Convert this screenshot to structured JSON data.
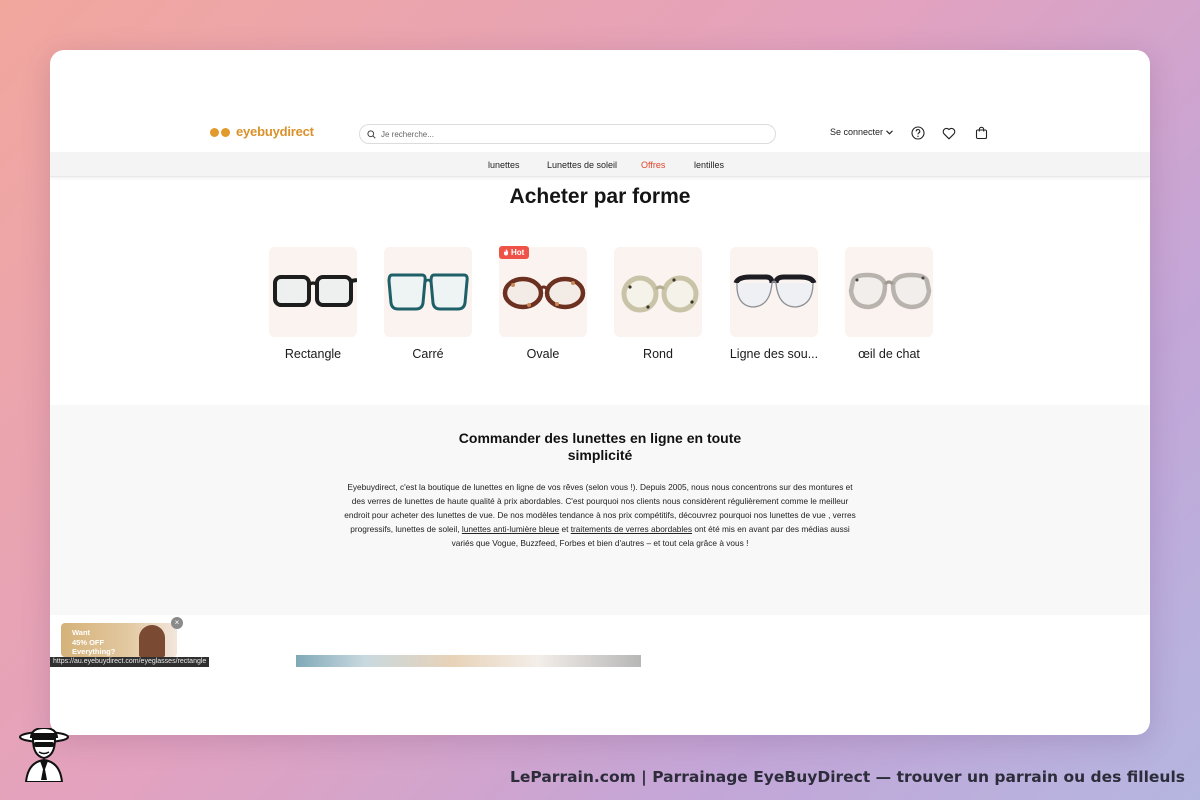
{
  "header": {
    "logo_text": "eyebuydirect",
    "search_placeholder": "Je recherche...",
    "login_label": "Se connecter",
    "icons": [
      "help-icon",
      "heart-icon",
      "cart-icon"
    ]
  },
  "nav": {
    "items": [
      {
        "label": "lunettes"
      },
      {
        "label": "Lunettes de soleil"
      },
      {
        "label": "Offres",
        "color": "#e0452b"
      },
      {
        "label": "lentilles"
      }
    ]
  },
  "shapes": {
    "title": "Acheter par forme",
    "badge": "Hot",
    "items": [
      {
        "label": "Rectangle",
        "frame_color": "#1d1d1d"
      },
      {
        "label": "Carré",
        "frame_color": "#1f6068"
      },
      {
        "label": "Ovale",
        "frame_color": "#6b3020",
        "hot": true
      },
      {
        "label": "Rond",
        "frame_color": "#c9c3a8"
      },
      {
        "label": "Ligne des sou...",
        "frame_color": "#1c1c22"
      },
      {
        "label": "œil de chat",
        "frame_color": "#b9b3ad"
      }
    ]
  },
  "info": {
    "title": "Commander des lunettes en ligne en toute simplicité",
    "p1": "Eyebuydirect, c'est la boutique de lunettes en ligne de vos rêves (selon vous !). Depuis 2005, nous nous concentrons sur des montures et des verres de lunettes de haute qualité à prix abordables. C'est pourquoi nos clients nous considèrent régulièrement comme le meilleur endroit pour acheter des lunettes de vue. De nos modèles tendance à nos prix compétitifs, découvrez pourquoi nos lunettes de vue , verres progressifs, lunettes de soleil,",
    "link1": "lunettes anti-lumière bleue",
    "and": "et",
    "link2": "traitements de verres abordables",
    "p2": "ont été mis en avant par des médias aussi variés que Vogue, Buzzfeed, Forbes et bien d'autres – et tout cela grâce à vous !"
  },
  "promo": {
    "line1": "Want",
    "line2": "45% OFF",
    "line3": "Everything?",
    "close": "×"
  },
  "status_url": "https://au.eyebuydirect.com/eyeglasses/rectangle",
  "credit": "LeParrain.com | Parrainage EyeBuyDirect — trouver un parrain ou des filleuls",
  "colors": {
    "brand": "#d9922b",
    "promo_red": "#e0452b",
    "hot_badge": "#ef5348"
  }
}
